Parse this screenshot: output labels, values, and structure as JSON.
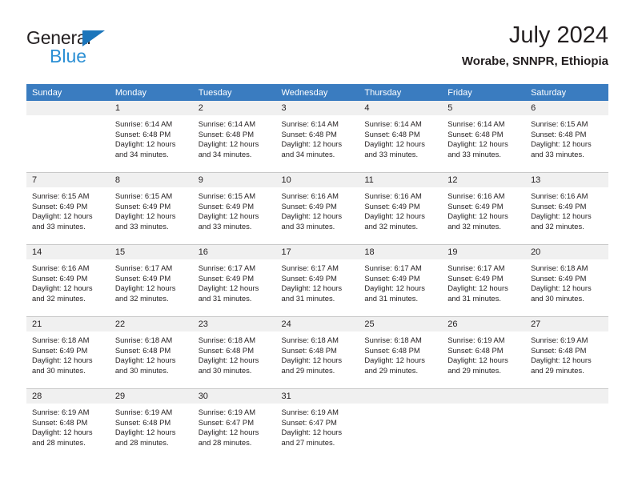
{
  "brand": {
    "name_part1": "General",
    "name_part2": "Blue",
    "triangle_color": "#1b75bb",
    "blue_color": "#2b8fd4"
  },
  "header": {
    "title": "July 2024",
    "subtitle": "Worabe, SNNPR, Ethiopia"
  },
  "theme": {
    "header_bg": "#3a7cc0",
    "daynum_bg": "#f0f0f0",
    "grid_line": "#c8c8c8",
    "text": "#231f20"
  },
  "weekdays": [
    "Sunday",
    "Monday",
    "Tuesday",
    "Wednesday",
    "Thursday",
    "Friday",
    "Saturday"
  ],
  "labels": {
    "sunrise": "Sunrise:",
    "sunset": "Sunset:",
    "daylight": "Daylight:"
  },
  "weeks": [
    [
      {
        "day": "",
        "sunrise": "",
        "sunset": "",
        "daylight_line1": "",
        "daylight_line2": ""
      },
      {
        "day": "1",
        "sunrise": "Sunrise: 6:14 AM",
        "sunset": "Sunset: 6:48 PM",
        "daylight_line1": "Daylight: 12 hours",
        "daylight_line2": "and 34 minutes."
      },
      {
        "day": "2",
        "sunrise": "Sunrise: 6:14 AM",
        "sunset": "Sunset: 6:48 PM",
        "daylight_line1": "Daylight: 12 hours",
        "daylight_line2": "and 34 minutes."
      },
      {
        "day": "3",
        "sunrise": "Sunrise: 6:14 AM",
        "sunset": "Sunset: 6:48 PM",
        "daylight_line1": "Daylight: 12 hours",
        "daylight_line2": "and 34 minutes."
      },
      {
        "day": "4",
        "sunrise": "Sunrise: 6:14 AM",
        "sunset": "Sunset: 6:48 PM",
        "daylight_line1": "Daylight: 12 hours",
        "daylight_line2": "and 33 minutes."
      },
      {
        "day": "5",
        "sunrise": "Sunrise: 6:14 AM",
        "sunset": "Sunset: 6:48 PM",
        "daylight_line1": "Daylight: 12 hours",
        "daylight_line2": "and 33 minutes."
      },
      {
        "day": "6",
        "sunrise": "Sunrise: 6:15 AM",
        "sunset": "Sunset: 6:48 PM",
        "daylight_line1": "Daylight: 12 hours",
        "daylight_line2": "and 33 minutes."
      }
    ],
    [
      {
        "day": "7",
        "sunrise": "Sunrise: 6:15 AM",
        "sunset": "Sunset: 6:49 PM",
        "daylight_line1": "Daylight: 12 hours",
        "daylight_line2": "and 33 minutes."
      },
      {
        "day": "8",
        "sunrise": "Sunrise: 6:15 AM",
        "sunset": "Sunset: 6:49 PM",
        "daylight_line1": "Daylight: 12 hours",
        "daylight_line2": "and 33 minutes."
      },
      {
        "day": "9",
        "sunrise": "Sunrise: 6:15 AM",
        "sunset": "Sunset: 6:49 PM",
        "daylight_line1": "Daylight: 12 hours",
        "daylight_line2": "and 33 minutes."
      },
      {
        "day": "10",
        "sunrise": "Sunrise: 6:16 AM",
        "sunset": "Sunset: 6:49 PM",
        "daylight_line1": "Daylight: 12 hours",
        "daylight_line2": "and 33 minutes."
      },
      {
        "day": "11",
        "sunrise": "Sunrise: 6:16 AM",
        "sunset": "Sunset: 6:49 PM",
        "daylight_line1": "Daylight: 12 hours",
        "daylight_line2": "and 32 minutes."
      },
      {
        "day": "12",
        "sunrise": "Sunrise: 6:16 AM",
        "sunset": "Sunset: 6:49 PM",
        "daylight_line1": "Daylight: 12 hours",
        "daylight_line2": "and 32 minutes."
      },
      {
        "day": "13",
        "sunrise": "Sunrise: 6:16 AM",
        "sunset": "Sunset: 6:49 PM",
        "daylight_line1": "Daylight: 12 hours",
        "daylight_line2": "and 32 minutes."
      }
    ],
    [
      {
        "day": "14",
        "sunrise": "Sunrise: 6:16 AM",
        "sunset": "Sunset: 6:49 PM",
        "daylight_line1": "Daylight: 12 hours",
        "daylight_line2": "and 32 minutes."
      },
      {
        "day": "15",
        "sunrise": "Sunrise: 6:17 AM",
        "sunset": "Sunset: 6:49 PM",
        "daylight_line1": "Daylight: 12 hours",
        "daylight_line2": "and 32 minutes."
      },
      {
        "day": "16",
        "sunrise": "Sunrise: 6:17 AM",
        "sunset": "Sunset: 6:49 PM",
        "daylight_line1": "Daylight: 12 hours",
        "daylight_line2": "and 31 minutes."
      },
      {
        "day": "17",
        "sunrise": "Sunrise: 6:17 AM",
        "sunset": "Sunset: 6:49 PM",
        "daylight_line1": "Daylight: 12 hours",
        "daylight_line2": "and 31 minutes."
      },
      {
        "day": "18",
        "sunrise": "Sunrise: 6:17 AM",
        "sunset": "Sunset: 6:49 PM",
        "daylight_line1": "Daylight: 12 hours",
        "daylight_line2": "and 31 minutes."
      },
      {
        "day": "19",
        "sunrise": "Sunrise: 6:17 AM",
        "sunset": "Sunset: 6:49 PM",
        "daylight_line1": "Daylight: 12 hours",
        "daylight_line2": "and 31 minutes."
      },
      {
        "day": "20",
        "sunrise": "Sunrise: 6:18 AM",
        "sunset": "Sunset: 6:49 PM",
        "daylight_line1": "Daylight: 12 hours",
        "daylight_line2": "and 30 minutes."
      }
    ],
    [
      {
        "day": "21",
        "sunrise": "Sunrise: 6:18 AM",
        "sunset": "Sunset: 6:49 PM",
        "daylight_line1": "Daylight: 12 hours",
        "daylight_line2": "and 30 minutes."
      },
      {
        "day": "22",
        "sunrise": "Sunrise: 6:18 AM",
        "sunset": "Sunset: 6:48 PM",
        "daylight_line1": "Daylight: 12 hours",
        "daylight_line2": "and 30 minutes."
      },
      {
        "day": "23",
        "sunrise": "Sunrise: 6:18 AM",
        "sunset": "Sunset: 6:48 PM",
        "daylight_line1": "Daylight: 12 hours",
        "daylight_line2": "and 30 minutes."
      },
      {
        "day": "24",
        "sunrise": "Sunrise: 6:18 AM",
        "sunset": "Sunset: 6:48 PM",
        "daylight_line1": "Daylight: 12 hours",
        "daylight_line2": "and 29 minutes."
      },
      {
        "day": "25",
        "sunrise": "Sunrise: 6:18 AM",
        "sunset": "Sunset: 6:48 PM",
        "daylight_line1": "Daylight: 12 hours",
        "daylight_line2": "and 29 minutes."
      },
      {
        "day": "26",
        "sunrise": "Sunrise: 6:19 AM",
        "sunset": "Sunset: 6:48 PM",
        "daylight_line1": "Daylight: 12 hours",
        "daylight_line2": "and 29 minutes."
      },
      {
        "day": "27",
        "sunrise": "Sunrise: 6:19 AM",
        "sunset": "Sunset: 6:48 PM",
        "daylight_line1": "Daylight: 12 hours",
        "daylight_line2": "and 29 minutes."
      }
    ],
    [
      {
        "day": "28",
        "sunrise": "Sunrise: 6:19 AM",
        "sunset": "Sunset: 6:48 PM",
        "daylight_line1": "Daylight: 12 hours",
        "daylight_line2": "and 28 minutes."
      },
      {
        "day": "29",
        "sunrise": "Sunrise: 6:19 AM",
        "sunset": "Sunset: 6:48 PM",
        "daylight_line1": "Daylight: 12 hours",
        "daylight_line2": "and 28 minutes."
      },
      {
        "day": "30",
        "sunrise": "Sunrise: 6:19 AM",
        "sunset": "Sunset: 6:47 PM",
        "daylight_line1": "Daylight: 12 hours",
        "daylight_line2": "and 28 minutes."
      },
      {
        "day": "31",
        "sunrise": "Sunrise: 6:19 AM",
        "sunset": "Sunset: 6:47 PM",
        "daylight_line1": "Daylight: 12 hours",
        "daylight_line2": "and 27 minutes."
      },
      {
        "day": "",
        "sunrise": "",
        "sunset": "",
        "daylight_line1": "",
        "daylight_line2": ""
      },
      {
        "day": "",
        "sunrise": "",
        "sunset": "",
        "daylight_line1": "",
        "daylight_line2": ""
      },
      {
        "day": "",
        "sunrise": "",
        "sunset": "",
        "daylight_line1": "",
        "daylight_line2": ""
      }
    ]
  ]
}
